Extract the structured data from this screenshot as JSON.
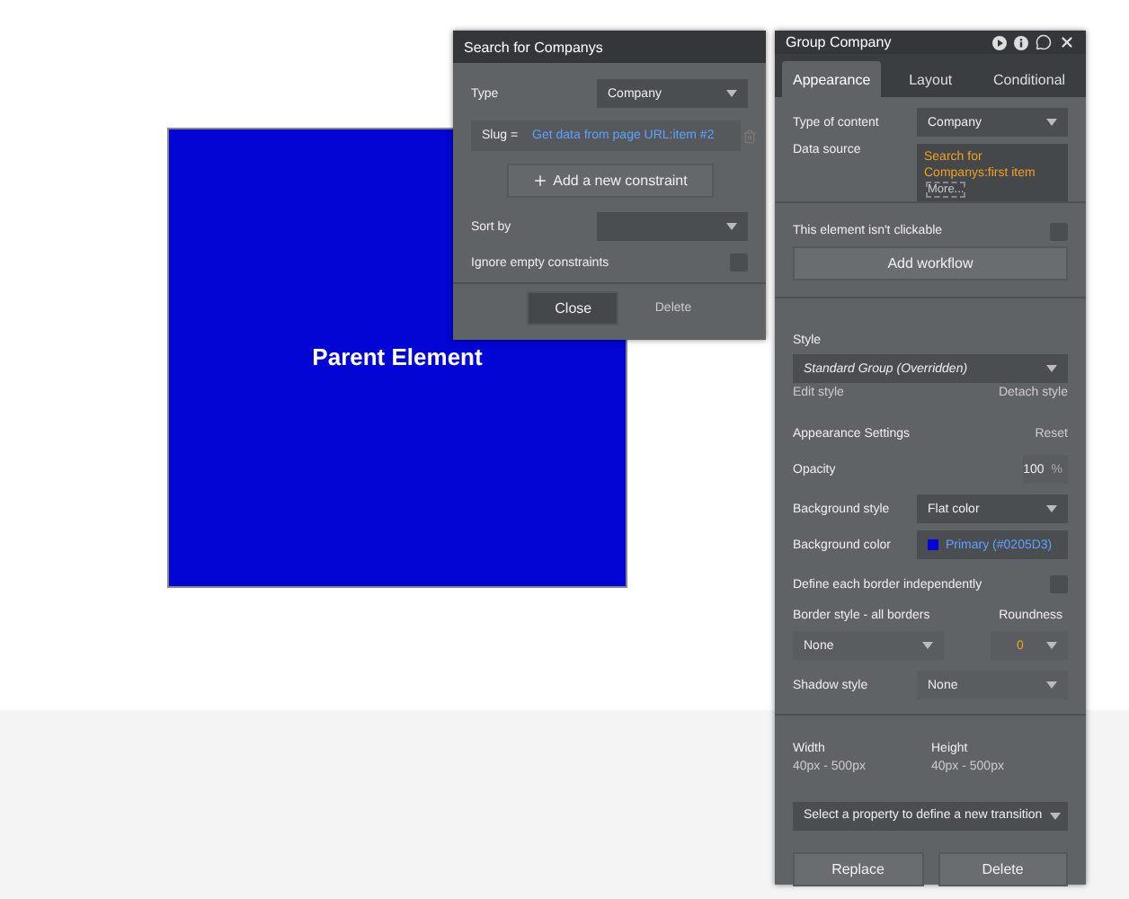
{
  "canvas": {
    "element": {
      "label": "Parent Element",
      "color": "#0205d3"
    }
  },
  "search_panel": {
    "title": "Search for Companys",
    "type": {
      "label": "Type",
      "value": "Company"
    },
    "constraints": [
      {
        "field": "Slug =",
        "value": "Get data from page URL:item #2"
      }
    ],
    "add_constraint": "Add a new constraint",
    "sort_by": {
      "label": "Sort by"
    },
    "ignore_empty": {
      "label": "Ignore empty constraints",
      "checked": false
    },
    "close": "Close",
    "delete": "Delete"
  },
  "property_panel": {
    "title": "Group Company",
    "tabs": [
      {
        "label": "Appearance",
        "selected": true
      },
      {
        "label": "Layout",
        "selected": false
      },
      {
        "label": "Conditional",
        "selected": false
      }
    ],
    "type_of_content": {
      "label": "Type of content",
      "value": "Company"
    },
    "data_source": {
      "label": "Data source",
      "value": "Search for Companys:first item",
      "more": "More..."
    },
    "not_clickable": {
      "label": "This element isn't clickable",
      "checked": false
    },
    "add_workflow": "Add workflow",
    "style": {
      "label": "Style",
      "value": "Standard Group (Overridden)",
      "edit": "Edit style",
      "detach": "Detach style"
    },
    "appearance_settings": {
      "label": "Appearance Settings",
      "reset": "Reset"
    },
    "opacity": {
      "label": "Opacity",
      "value": "100",
      "unit": "%"
    },
    "background_style": {
      "label": "Background style",
      "value": "Flat color"
    },
    "background_color": {
      "label": "Background color",
      "value": "Primary (#0205D3)",
      "color": "#0205d3"
    },
    "border_independent": {
      "label": "Define each border independently",
      "checked": false
    },
    "border_style": {
      "label": "Border style - all borders",
      "value": "None"
    },
    "roundness": {
      "label": "Roundness",
      "value": "0"
    },
    "shadow_style": {
      "label": "Shadow style",
      "value": "None"
    },
    "width": {
      "label": "Width",
      "value": "40px - 500px"
    },
    "height": {
      "label": "Height",
      "value": "40px - 500px"
    },
    "transition": {
      "placeholder": "Select a property to define a new transition"
    },
    "replace": "Replace",
    "delete": "Delete"
  }
}
